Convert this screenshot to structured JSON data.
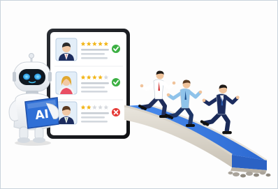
{
  "robot": {
    "badge_text": "AI"
  },
  "candidates": [
    {
      "rating": 5,
      "max_rating": 5,
      "status": "accepted",
      "avatar": "man-dark-hair-icon"
    },
    {
      "rating": 4,
      "max_rating": 5,
      "status": "accepted",
      "avatar": "woman-blonde-hair-icon"
    },
    {
      "rating": 2,
      "max_rating": 5,
      "status": "rejected",
      "avatar": "man-brown-hair-icon"
    }
  ],
  "runners": [
    {
      "shirt": "#ffffff",
      "tie": "#d02828",
      "pants": "#1f2d5a"
    },
    {
      "shirt": "#8fc3ea",
      "tie": "#1d4f8c",
      "pants": "#1d3566"
    },
    {
      "shirt": "#ffffff",
      "tie": "#2a5db0",
      "pants": "#1a2a58",
      "jacket": "#1c2c5e"
    }
  ],
  "colors": {
    "accent_blue": "#2f6fd6",
    "star_gold": "#f2b619",
    "check_green": "#3cb043",
    "reject_red": "#e53935",
    "bridge_blue": "#3a7be0",
    "frame": "#c9d3dc"
  }
}
